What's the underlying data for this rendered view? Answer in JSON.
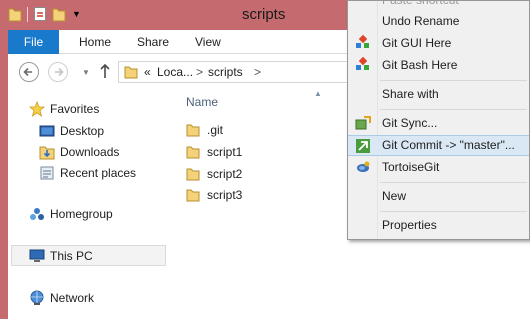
{
  "window": {
    "title": "scripts"
  },
  "quick_access": {
    "icons": [
      "folder-icon",
      "properties-icon",
      "new-folder-icon",
      "dropdown-icon"
    ]
  },
  "ribbon": {
    "tabs": [
      "File",
      "Home",
      "Share",
      "View"
    ]
  },
  "address": {
    "chevrons": "«",
    "segments": [
      "Loca...",
      "scripts"
    ],
    "separator": ">"
  },
  "nav_pane": {
    "favorites": "Favorites",
    "desktop": "Desktop",
    "downloads": "Downloads",
    "recent_places": "Recent places",
    "homegroup": "Homegroup",
    "this_pc": "This PC",
    "network": "Network"
  },
  "file_list": {
    "column_name": "Name",
    "items": [
      ".git",
      "script1",
      "script2",
      "script3"
    ]
  },
  "context_menu": {
    "items": {
      "cut_off": "Paste shortcut",
      "undo_rename": "Undo Rename",
      "git_gui_here": "Git GUI Here",
      "git_bash_here": "Git Bash Here",
      "share_with": "Share with",
      "git_sync": "Git Sync...",
      "git_commit": "Git Commit -> \"master\"...",
      "tortoisegit": "TortoiseGit",
      "new": "New",
      "properties": "Properties"
    },
    "highlighted": "git_commit"
  },
  "colors": {
    "title_bar": "#c56a6f",
    "file_tab": "#1979ca",
    "menu_background": "#f0f0f0",
    "menu_highlight": "#dae8f5",
    "column_header": "#4c607a"
  }
}
